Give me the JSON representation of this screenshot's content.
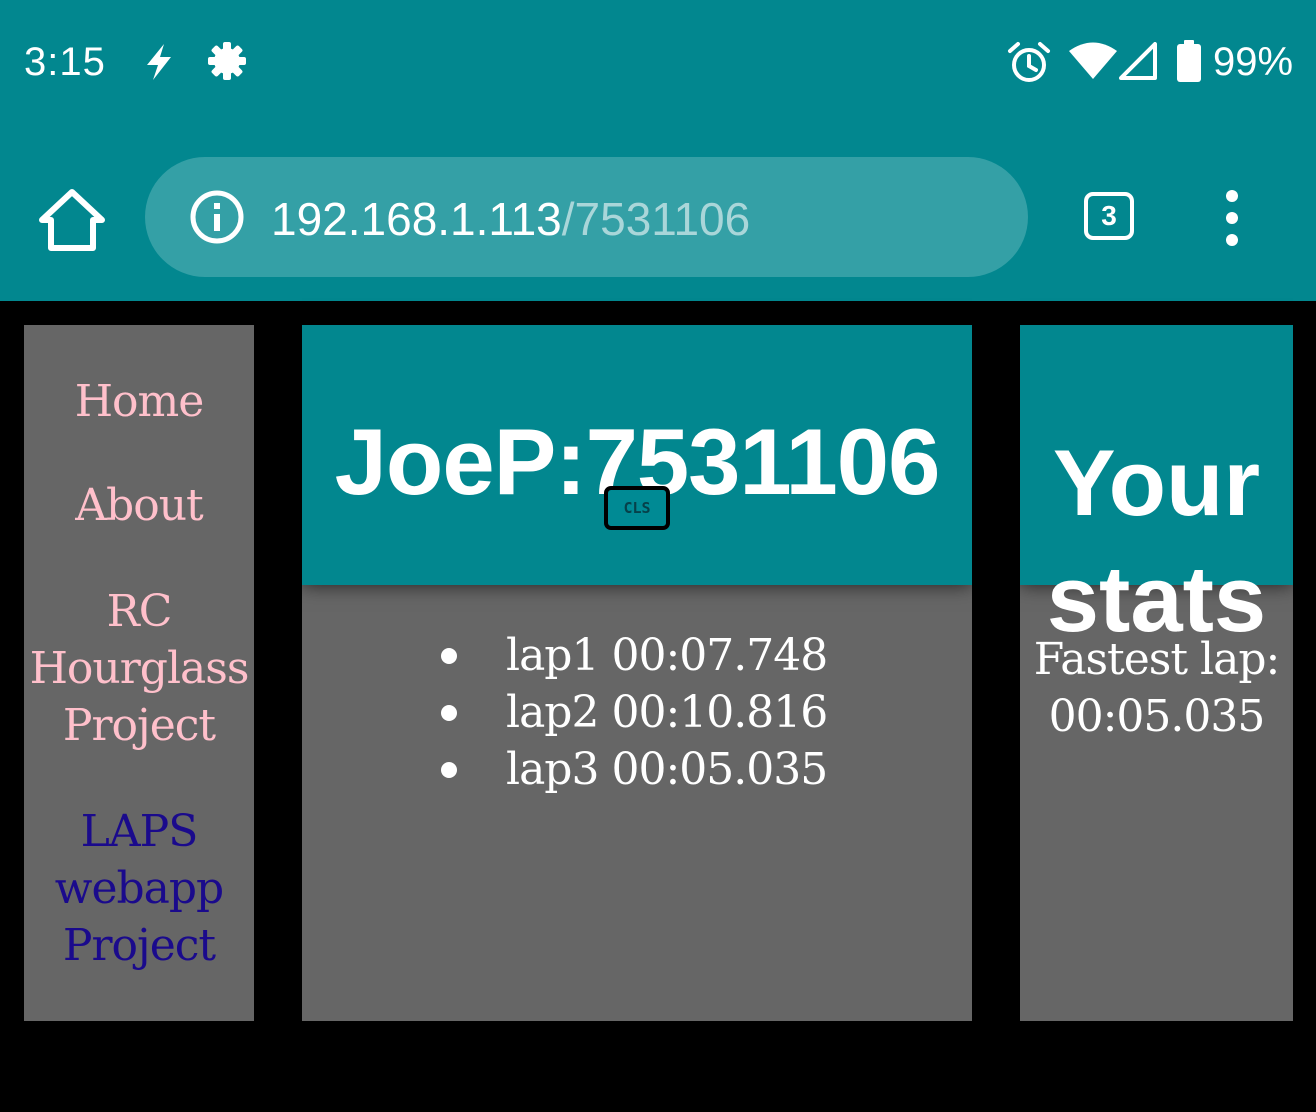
{
  "status_bar": {
    "time": "3:15",
    "battery_percent": "99%",
    "icons": [
      "bolt-icon",
      "gear-icon",
      "alarm-icon",
      "wifi-icon",
      "signal-icon",
      "battery-icon"
    ]
  },
  "browser": {
    "url_host": "192.168.1.113",
    "url_path": "/7531106",
    "tab_count": "3",
    "icons": [
      "home-icon",
      "info-icon",
      "tabs-icon",
      "menu-icon"
    ]
  },
  "nav": {
    "items": [
      {
        "label": "Home"
      },
      {
        "label": "About"
      },
      {
        "label": "RC Hourglass Project"
      },
      {
        "label": "LAPS webapp Project"
      }
    ]
  },
  "main": {
    "title": "JoeP:7531106",
    "cls_button": "CLS",
    "laps": [
      {
        "label": "lap1 00:07.748"
      },
      {
        "label": "lap2 00:10.816"
      },
      {
        "label": "lap3 00:05.035"
      }
    ]
  },
  "stats": {
    "title": "Your stats",
    "fastest_label": "Fastest lap:",
    "fastest_value": "00:05.035"
  },
  "colors": {
    "chrome": "#02878f",
    "address_bar": "#34a0a6",
    "panel": "#666666",
    "nav_link": "#ffc0cb",
    "nav_link_active": "#1a0a8c",
    "page_bg": "#000000"
  }
}
